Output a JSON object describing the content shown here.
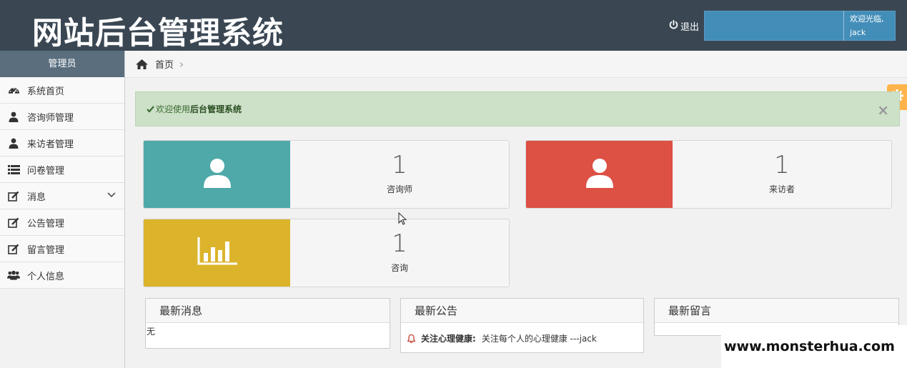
{
  "header": {
    "title": "网站后台管理系统",
    "logout_label": "退出",
    "welcome_line1": "欢迎光临,",
    "welcome_user": "jack"
  },
  "sidebar": {
    "title": "管理员",
    "items": [
      {
        "label": "系统首页",
        "icon": "dashboard-icon"
      },
      {
        "label": "咨询师管理",
        "icon": "user-icon"
      },
      {
        "label": "来访者管理",
        "icon": "user-icon"
      },
      {
        "label": "问卷管理",
        "icon": "list-icon"
      },
      {
        "label": "消息",
        "icon": "edit-icon",
        "has_submenu": true
      },
      {
        "label": "公告管理",
        "icon": "edit-icon"
      },
      {
        "label": "留言管理",
        "icon": "edit-icon"
      },
      {
        "label": "个人信息",
        "icon": "users-icon"
      }
    ]
  },
  "breadcrumb": {
    "home_label": "首页",
    "separator": "›"
  },
  "alert": {
    "prefix": "欢迎使用",
    "strong": "后台管理系统",
    "close": "×"
  },
  "stats": [
    {
      "value": "1",
      "label": "咨询师",
      "color": "#4fa9a9",
      "icon": "user-icon"
    },
    {
      "value": "1",
      "label": "来访者",
      "color": "#dd5044",
      "icon": "user-icon"
    },
    {
      "value": "1",
      "label": "咨询",
      "color": "#dcb42c",
      "icon": "bar-chart-icon"
    }
  ],
  "panels": {
    "messages": {
      "title": "最新消息",
      "empty": "无"
    },
    "notices": {
      "title": "最新公告",
      "item_title": "关注心理健康:",
      "item_text": "关注每个人的心理健康 ---jack"
    },
    "comments": {
      "title": "最新留言"
    }
  },
  "watermark": "www.monsterhua.com",
  "colors": {
    "header_bg": "#3a4753",
    "accent_blue": "#438eb9",
    "alert_bg": "#cde0c8",
    "gear_tab": "#ffb44b"
  }
}
